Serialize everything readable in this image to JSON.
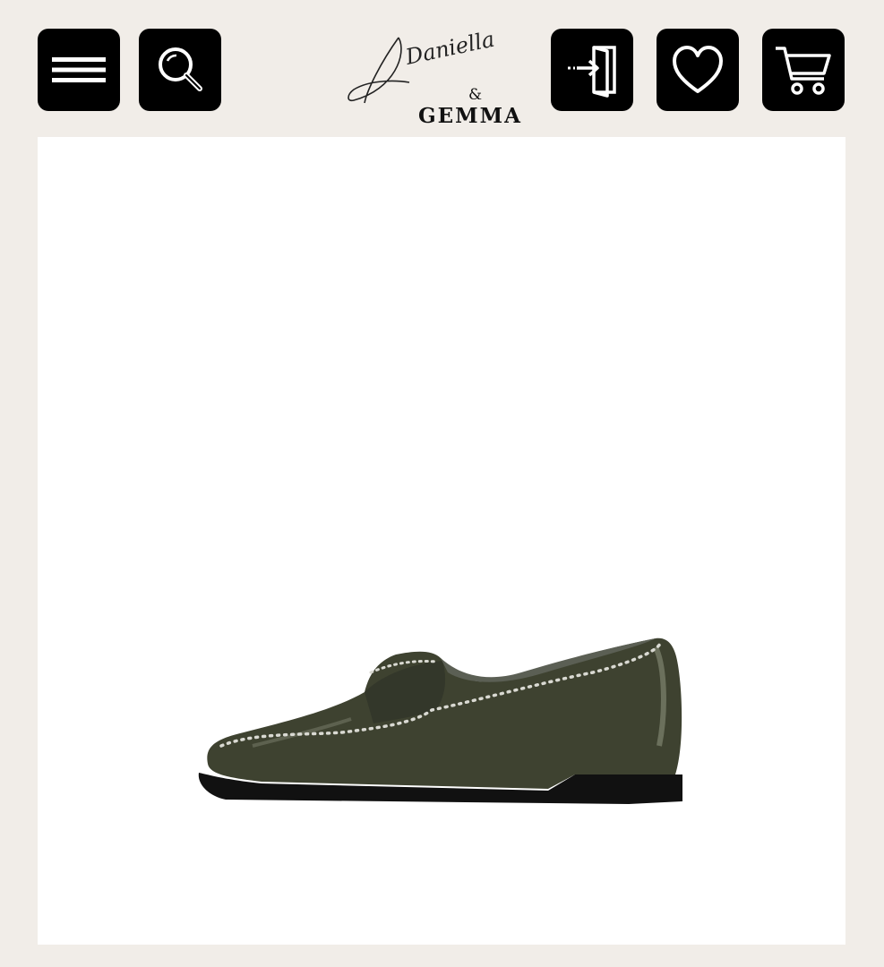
{
  "header": {
    "menu_button": {
      "icon": "hamburger-menu-icon"
    },
    "search_button": {
      "icon": "magnifier-search-icon"
    },
    "logo": {
      "script_text": "Daniella",
      "ampersand": "&",
      "wordmark": "GEMMA"
    },
    "login_button": {
      "icon": "door-enter-icon"
    },
    "wishlist_button": {
      "icon": "heart-icon"
    },
    "cart_button": {
      "icon": "shopping-cart-icon"
    }
  },
  "product": {
    "image": "olive-green-patent-studded-loafer",
    "colors": {
      "upper": "#3e4230",
      "sole": "#111111",
      "studs": "#d9d9d2"
    }
  },
  "colors": {
    "page_background": "#f1ede8",
    "button_background": "#000000",
    "panel_background": "#ffffff"
  }
}
